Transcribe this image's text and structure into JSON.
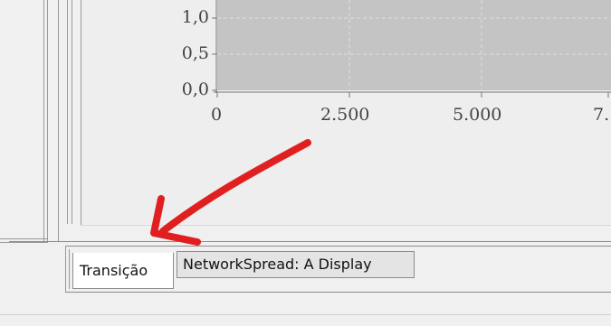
{
  "chart": {
    "y_ticks": [
      "1,0",
      "0,5",
      "0,0"
    ],
    "x_ticks": [
      "0",
      "2.500",
      "5.000",
      "7."
    ]
  },
  "tabs": [
    {
      "label": "Transição",
      "active": true
    },
    {
      "label": "NetworkSpread: A Display",
      "active": false
    }
  ],
  "annotation": {
    "color": "#e02020"
  }
}
